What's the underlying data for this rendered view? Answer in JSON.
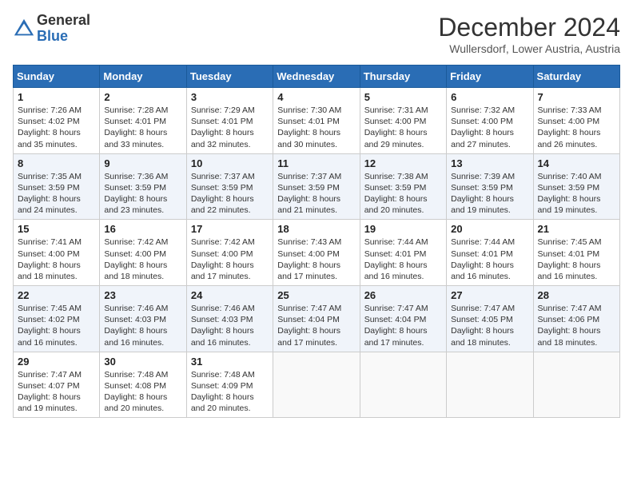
{
  "header": {
    "logo_line1": "General",
    "logo_line2": "Blue",
    "month": "December 2024",
    "location": "Wullersdorf, Lower Austria, Austria"
  },
  "weekdays": [
    "Sunday",
    "Monday",
    "Tuesday",
    "Wednesday",
    "Thursday",
    "Friday",
    "Saturday"
  ],
  "weeks": [
    [
      {
        "day": "1",
        "sunrise": "Sunrise: 7:26 AM",
        "sunset": "Sunset: 4:02 PM",
        "daylight": "Daylight: 8 hours and 35 minutes."
      },
      {
        "day": "2",
        "sunrise": "Sunrise: 7:28 AM",
        "sunset": "Sunset: 4:01 PM",
        "daylight": "Daylight: 8 hours and 33 minutes."
      },
      {
        "day": "3",
        "sunrise": "Sunrise: 7:29 AM",
        "sunset": "Sunset: 4:01 PM",
        "daylight": "Daylight: 8 hours and 32 minutes."
      },
      {
        "day": "4",
        "sunrise": "Sunrise: 7:30 AM",
        "sunset": "Sunset: 4:01 PM",
        "daylight": "Daylight: 8 hours and 30 minutes."
      },
      {
        "day": "5",
        "sunrise": "Sunrise: 7:31 AM",
        "sunset": "Sunset: 4:00 PM",
        "daylight": "Daylight: 8 hours and 29 minutes."
      },
      {
        "day": "6",
        "sunrise": "Sunrise: 7:32 AM",
        "sunset": "Sunset: 4:00 PM",
        "daylight": "Daylight: 8 hours and 27 minutes."
      },
      {
        "day": "7",
        "sunrise": "Sunrise: 7:33 AM",
        "sunset": "Sunset: 4:00 PM",
        "daylight": "Daylight: 8 hours and 26 minutes."
      }
    ],
    [
      {
        "day": "8",
        "sunrise": "Sunrise: 7:35 AM",
        "sunset": "Sunset: 3:59 PM",
        "daylight": "Daylight: 8 hours and 24 minutes."
      },
      {
        "day": "9",
        "sunrise": "Sunrise: 7:36 AM",
        "sunset": "Sunset: 3:59 PM",
        "daylight": "Daylight: 8 hours and 23 minutes."
      },
      {
        "day": "10",
        "sunrise": "Sunrise: 7:37 AM",
        "sunset": "Sunset: 3:59 PM",
        "daylight": "Daylight: 8 hours and 22 minutes."
      },
      {
        "day": "11",
        "sunrise": "Sunrise: 7:37 AM",
        "sunset": "Sunset: 3:59 PM",
        "daylight": "Daylight: 8 hours and 21 minutes."
      },
      {
        "day": "12",
        "sunrise": "Sunrise: 7:38 AM",
        "sunset": "Sunset: 3:59 PM",
        "daylight": "Daylight: 8 hours and 20 minutes."
      },
      {
        "day": "13",
        "sunrise": "Sunrise: 7:39 AM",
        "sunset": "Sunset: 3:59 PM",
        "daylight": "Daylight: 8 hours and 19 minutes."
      },
      {
        "day": "14",
        "sunrise": "Sunrise: 7:40 AM",
        "sunset": "Sunset: 3:59 PM",
        "daylight": "Daylight: 8 hours and 19 minutes."
      }
    ],
    [
      {
        "day": "15",
        "sunrise": "Sunrise: 7:41 AM",
        "sunset": "Sunset: 4:00 PM",
        "daylight": "Daylight: 8 hours and 18 minutes."
      },
      {
        "day": "16",
        "sunrise": "Sunrise: 7:42 AM",
        "sunset": "Sunset: 4:00 PM",
        "daylight": "Daylight: 8 hours and 18 minutes."
      },
      {
        "day": "17",
        "sunrise": "Sunrise: 7:42 AM",
        "sunset": "Sunset: 4:00 PM",
        "daylight": "Daylight: 8 hours and 17 minutes."
      },
      {
        "day": "18",
        "sunrise": "Sunrise: 7:43 AM",
        "sunset": "Sunset: 4:00 PM",
        "daylight": "Daylight: 8 hours and 17 minutes."
      },
      {
        "day": "19",
        "sunrise": "Sunrise: 7:44 AM",
        "sunset": "Sunset: 4:01 PM",
        "daylight": "Daylight: 8 hours and 16 minutes."
      },
      {
        "day": "20",
        "sunrise": "Sunrise: 7:44 AM",
        "sunset": "Sunset: 4:01 PM",
        "daylight": "Daylight: 8 hours and 16 minutes."
      },
      {
        "day": "21",
        "sunrise": "Sunrise: 7:45 AM",
        "sunset": "Sunset: 4:01 PM",
        "daylight": "Daylight: 8 hours and 16 minutes."
      }
    ],
    [
      {
        "day": "22",
        "sunrise": "Sunrise: 7:45 AM",
        "sunset": "Sunset: 4:02 PM",
        "daylight": "Daylight: 8 hours and 16 minutes."
      },
      {
        "day": "23",
        "sunrise": "Sunrise: 7:46 AM",
        "sunset": "Sunset: 4:03 PM",
        "daylight": "Daylight: 8 hours and 16 minutes."
      },
      {
        "day": "24",
        "sunrise": "Sunrise: 7:46 AM",
        "sunset": "Sunset: 4:03 PM",
        "daylight": "Daylight: 8 hours and 16 minutes."
      },
      {
        "day": "25",
        "sunrise": "Sunrise: 7:47 AM",
        "sunset": "Sunset: 4:04 PM",
        "daylight": "Daylight: 8 hours and 17 minutes."
      },
      {
        "day": "26",
        "sunrise": "Sunrise: 7:47 AM",
        "sunset": "Sunset: 4:04 PM",
        "daylight": "Daylight: 8 hours and 17 minutes."
      },
      {
        "day": "27",
        "sunrise": "Sunrise: 7:47 AM",
        "sunset": "Sunset: 4:05 PM",
        "daylight": "Daylight: 8 hours and 18 minutes."
      },
      {
        "day": "28",
        "sunrise": "Sunrise: 7:47 AM",
        "sunset": "Sunset: 4:06 PM",
        "daylight": "Daylight: 8 hours and 18 minutes."
      }
    ],
    [
      {
        "day": "29",
        "sunrise": "Sunrise: 7:47 AM",
        "sunset": "Sunset: 4:07 PM",
        "daylight": "Daylight: 8 hours and 19 minutes."
      },
      {
        "day": "30",
        "sunrise": "Sunrise: 7:48 AM",
        "sunset": "Sunset: 4:08 PM",
        "daylight": "Daylight: 8 hours and 20 minutes."
      },
      {
        "day": "31",
        "sunrise": "Sunrise: 7:48 AM",
        "sunset": "Sunset: 4:09 PM",
        "daylight": "Daylight: 8 hours and 20 minutes."
      },
      null,
      null,
      null,
      null
    ]
  ]
}
